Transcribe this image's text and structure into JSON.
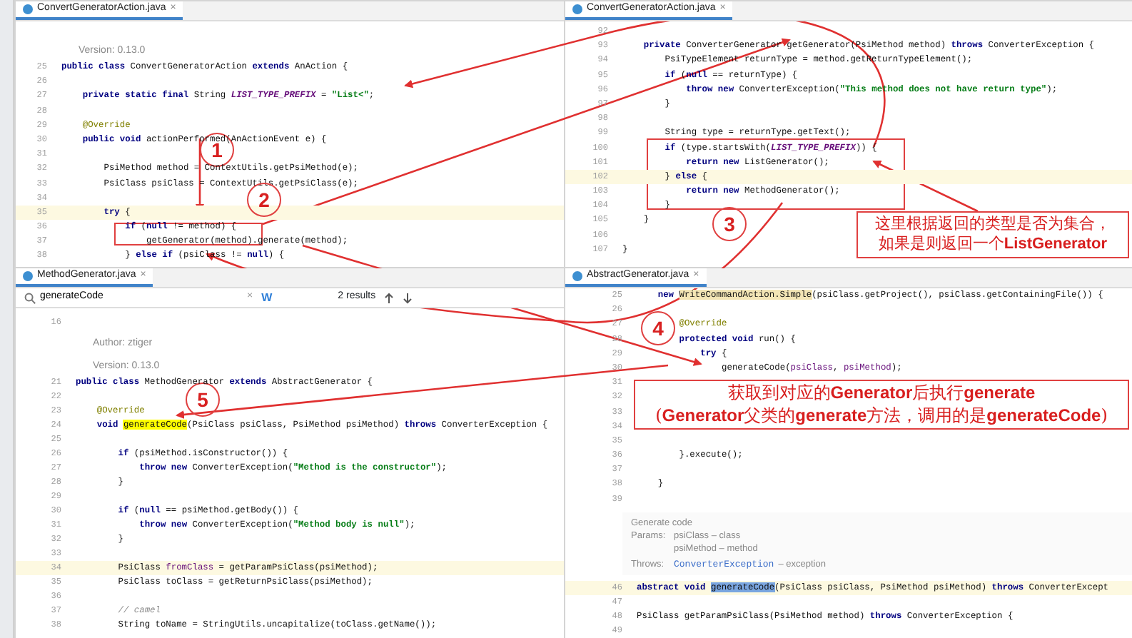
{
  "panes": [
    {
      "tab": {
        "label": "ConvertGeneratorAction.java",
        "close": "×"
      },
      "lines": [
        {
          "kind": "doc",
          "text": "Version: 0.13.0"
        },
        {
          "kind": "code",
          "num": "25",
          "current": false,
          "segs": [
            {
              "text": "public class ",
              "kind": "keyword"
            },
            {
              "text": "ConvertGeneratorAction "
            },
            {
              "text": "extends ",
              "kind": "keyword"
            },
            {
              "text": "AnAction {"
            }
          ]
        },
        {
          "kind": "code",
          "num": "26",
          "current": false
        },
        {
          "kind": "code",
          "num": "27",
          "current": false,
          "segs": [
            {
              "text": "    private static final ",
              "kind": "keyword"
            },
            {
              "text": "String "
            },
            {
              "text": "LIST_TYPE_PREFIX",
              "kind": "constant"
            },
            {
              "text": " = "
            },
            {
              "text": "\"List<\"",
              "kind": "string"
            },
            {
              "text": ";"
            }
          ]
        },
        {
          "kind": "code",
          "num": "28",
          "current": false
        },
        {
          "kind": "code",
          "num": "29",
          "current": false,
          "segs": [
            {
              "text": "    @Override",
              "kind": "annotation"
            }
          ]
        },
        {
          "kind": "code",
          "num": "30",
          "current": false,
          "segs": [
            {
              "text": "    public void ",
              "kind": "keyword"
            },
            {
              "text": "actionPerformed(AnActionEvent e) {"
            }
          ]
        },
        {
          "kind": "code",
          "num": "31",
          "current": false
        },
        {
          "kind": "code",
          "num": "32",
          "current": false,
          "segs": [
            {
              "text": "        PsiMethod method = ContextUtils.getPsiMethod(e);"
            }
          ]
        },
        {
          "kind": "code",
          "num": "33",
          "current": false,
          "segs": [
            {
              "text": "        PsiClass psiClass = ContextUtils.getPsiClass(e);"
            }
          ]
        },
        {
          "kind": "code",
          "num": "34",
          "current": false
        },
        {
          "kind": "code",
          "num": "35",
          "current": true,
          "segs": [
            {
              "text": "        try ",
              "kind": "keyword"
            },
            {
              "text": "{"
            }
          ]
        },
        {
          "kind": "code",
          "num": "36",
          "current": false,
          "segs": [
            {
              "text": "            if ",
              "kind": "keyword"
            },
            {
              "text": "("
            },
            {
              "text": "null",
              "kind": "keyword"
            },
            {
              "text": " != method) {"
            }
          ]
        },
        {
          "kind": "code",
          "num": "37",
          "current": false,
          "segs": [
            {
              "text": "                getGenerator(method).generate(method);"
            }
          ]
        },
        {
          "kind": "code",
          "num": "38",
          "current": false,
          "segs": [
            {
              "text": "            } "
            },
            {
              "text": "else if ",
              "kind": "keyword"
            },
            {
              "text": "(psiClass != "
            },
            {
              "text": "null",
              "kind": "keyword"
            },
            {
              "text": ") {"
            }
          ]
        }
      ]
    },
    {
      "tab": {
        "label": "ConvertGeneratorAction.java",
        "close": "×"
      },
      "lines": [
        {
          "kind": "code",
          "num": "92",
          "current": false
        },
        {
          "kind": "code",
          "num": "93",
          "current": false,
          "segs": [
            {
              "text": "    private ",
              "kind": "keyword"
            },
            {
              "text": "ConverterGenerator getGenerator(PsiMethod method) "
            },
            {
              "text": "throws ",
              "kind": "keyword"
            },
            {
              "text": "ConverterException {"
            }
          ]
        },
        {
          "kind": "code",
          "num": "94",
          "current": false,
          "segs": [
            {
              "text": "        PsiTypeElement returnType = method.getReturnTypeElement();"
            }
          ]
        },
        {
          "kind": "code",
          "num": "95",
          "current": false,
          "segs": [
            {
              "text": "        if ",
              "kind": "keyword"
            },
            {
              "text": "("
            },
            {
              "text": "null",
              "kind": "keyword"
            },
            {
              "text": " == returnType) {"
            }
          ]
        },
        {
          "kind": "code",
          "num": "96",
          "current": false,
          "segs": [
            {
              "text": "            throw new ",
              "kind": "keyword"
            },
            {
              "text": "ConverterException("
            },
            {
              "text": "\"This method does not have return type\"",
              "kind": "string"
            },
            {
              "text": ");"
            }
          ]
        },
        {
          "kind": "code",
          "num": "97",
          "current": false,
          "segs": [
            {
              "text": "        }"
            }
          ]
        },
        {
          "kind": "code",
          "num": "98",
          "current": false
        },
        {
          "kind": "code",
          "num": "99",
          "current": false,
          "segs": [
            {
              "text": "        String type = returnType.getText();"
            }
          ]
        },
        {
          "kind": "code",
          "num": "100",
          "current": false,
          "segs": [
            {
              "text": "        if ",
              "kind": "keyword"
            },
            {
              "text": "(type.startsWith("
            },
            {
              "text": "LIST_TYPE_PREFIX",
              "kind": "constant"
            },
            {
              "text": ")) {"
            }
          ]
        },
        {
          "kind": "code",
          "num": "101",
          "current": false,
          "segs": [
            {
              "text": "            return new ",
              "kind": "keyword"
            },
            {
              "text": "ListGenerator();"
            }
          ]
        },
        {
          "kind": "code",
          "num": "102",
          "current": true,
          "segs": [
            {
              "text": "        } "
            },
            {
              "text": "else ",
              "kind": "keyword"
            },
            {
              "text": "{"
            }
          ]
        },
        {
          "kind": "code",
          "num": "103",
          "current": false,
          "segs": [
            {
              "text": "            return new ",
              "kind": "keyword"
            },
            {
              "text": "MethodGenerator();"
            }
          ]
        },
        {
          "kind": "code",
          "num": "104",
          "current": false,
          "segs": [
            {
              "text": "        }"
            }
          ]
        },
        {
          "kind": "code",
          "num": "105",
          "current": false,
          "segs": [
            {
              "text": "    }"
            }
          ]
        },
        {
          "kind": "code",
          "num": "106",
          "current": false
        },
        {
          "kind": "code",
          "num": "107",
          "current": false,
          "segs": [
            {
              "text": "}"
            }
          ]
        }
      ]
    },
    {
      "tab": {
        "label": "MethodGenerator.java",
        "close": "×"
      },
      "search": {
        "value": "generateCode",
        "clear": "×",
        "toggle": {
          "label": "W",
          "on": true
        },
        "results": "2 results"
      },
      "lines": [
        {
          "kind": "code",
          "num": "16",
          "current": false
        },
        {
          "kind": "doc",
          "text": "Author: ztiger"
        },
        {
          "kind": "doc",
          "text": "Version: 0.13.0"
        },
        {
          "kind": "code",
          "num": "21",
          "current": false,
          "segs": [
            {
              "text": "public class ",
              "kind": "keyword"
            },
            {
              "text": "MethodGenerator "
            },
            {
              "text": "extends ",
              "kind": "keyword"
            },
            {
              "text": "AbstractGenerator {"
            }
          ]
        },
        {
          "kind": "code",
          "num": "22",
          "current": false
        },
        {
          "kind": "code",
          "num": "23",
          "current": false,
          "segs": [
            {
              "text": "    @Override",
              "kind": "annotation"
            }
          ]
        },
        {
          "kind": "code",
          "num": "24",
          "current": false,
          "segs": [
            {
              "text": "    void ",
              "kind": "keyword"
            },
            {
              "text": "generateCode",
              "kind": "match"
            },
            {
              "text": "(PsiClass psiClass, PsiMethod psiMethod) "
            },
            {
              "text": "throws ",
              "kind": "keyword"
            },
            {
              "text": "ConverterException {"
            }
          ]
        },
        {
          "kind": "code",
          "num": "25",
          "current": false
        },
        {
          "kind": "code",
          "num": "26",
          "current": false,
          "segs": [
            {
              "text": "        if ",
              "kind": "keyword"
            },
            {
              "text": "(psiMethod.isConstructor()) {"
            }
          ]
        },
        {
          "kind": "code",
          "num": "27",
          "current": false,
          "segs": [
            {
              "text": "            throw new ",
              "kind": "keyword"
            },
            {
              "text": "ConverterException("
            },
            {
              "text": "\"Method is the constructor\"",
              "kind": "string"
            },
            {
              "text": ");"
            }
          ]
        },
        {
          "kind": "code",
          "num": "28",
          "current": false,
          "segs": [
            {
              "text": "        }"
            }
          ]
        },
        {
          "kind": "code",
          "num": "29",
          "current": false
        },
        {
          "kind": "code",
          "num": "30",
          "current": false,
          "segs": [
            {
              "text": "        if ",
              "kind": "keyword"
            },
            {
              "text": "("
            },
            {
              "text": "null",
              "kind": "keyword"
            },
            {
              "text": " == psiMethod.getBody()) {"
            }
          ]
        },
        {
          "kind": "code",
          "num": "31",
          "current": false,
          "segs": [
            {
              "text": "            throw new ",
              "kind": "keyword"
            },
            {
              "text": "ConverterException("
            },
            {
              "text": "\"Method body is null\"",
              "kind": "string"
            },
            {
              "text": ");"
            }
          ]
        },
        {
          "kind": "code",
          "num": "32",
          "current": false,
          "segs": [
            {
              "text": "        }"
            }
          ]
        },
        {
          "kind": "code",
          "num": "33",
          "current": false
        },
        {
          "kind": "code",
          "num": "34",
          "current": true,
          "segs": [
            {
              "text": "        PsiClass "
            },
            {
              "text": "fromClass",
              "kind": "param"
            },
            {
              "text": " = getParamPsiClass(psiMethod);"
            }
          ]
        },
        {
          "kind": "code",
          "num": "35",
          "current": false,
          "segs": [
            {
              "text": "        PsiClass toClass = getReturnPsiClass(psiMethod);"
            }
          ]
        },
        {
          "kind": "code",
          "num": "36",
          "current": false
        },
        {
          "kind": "code",
          "num": "37",
          "current": false,
          "segs": [
            {
              "text": "        // camel",
              "kind": "comment"
            }
          ]
        },
        {
          "kind": "code",
          "num": "38",
          "current": false,
          "segs": [
            {
              "text": "        String toName = StringUtils.uncapitalize(toClass.getName());"
            }
          ]
        }
      ]
    },
    {
      "tab": {
        "label": "AbstractGenerator.java",
        "close": "×"
      },
      "lines": [
        {
          "kind": "code",
          "num": "25",
          "current": false,
          "segs": [
            {
              "text": "    new ",
              "kind": "keyword"
            },
            {
              "text": "WriteCommandAction.Simple",
              "kind": "warning"
            },
            {
              "text": "(psiClass.getProject(), psiClass.getContainingFile()) {"
            }
          ]
        },
        {
          "kind": "code",
          "num": "26",
          "current": false
        },
        {
          "kind": "code",
          "num": "27",
          "current": false,
          "segs": [
            {
              "text": "        @Override",
              "kind": "annotation"
            }
          ]
        },
        {
          "kind": "code",
          "num": "28",
          "current": false,
          "segs": [
            {
              "text": "        protected void ",
              "kind": "keyword"
            },
            {
              "text": "run() {"
            }
          ]
        },
        {
          "kind": "code",
          "num": "29",
          "current": false,
          "segs": [
            {
              "text": "            try ",
              "kind": "keyword"
            },
            {
              "text": "{"
            }
          ]
        },
        {
          "kind": "code",
          "num": "30",
          "current": false,
          "segs": [
            {
              "text": "                generateCode("
            },
            {
              "text": "psiClass",
              "kind": "param"
            },
            {
              "text": ", "
            },
            {
              "text": "psiMethod",
              "kind": "param"
            },
            {
              "text": ");"
            }
          ]
        },
        {
          "kind": "code",
          "num": "31",
          "current": false
        },
        {
          "kind": "code",
          "num": "32",
          "current": false
        },
        {
          "kind": "code",
          "num": "33",
          "current": false
        },
        {
          "kind": "code",
          "num": "34",
          "current": false
        },
        {
          "kind": "code",
          "num": "35",
          "current": false
        },
        {
          "kind": "code",
          "num": "36",
          "current": false,
          "segs": [
            {
              "text": "        }.execute();"
            }
          ]
        },
        {
          "kind": "code",
          "num": "37",
          "current": false
        },
        {
          "kind": "code",
          "num": "38",
          "current": false,
          "segs": [
            {
              "text": "    }"
            }
          ]
        },
        {
          "kind": "code",
          "num": "39",
          "current": false
        },
        {
          "kind": "javadoc",
          "title": "Generate code",
          "params_label": "Params:",
          "params": [
            "psiClass – class",
            "psiMethod – method"
          ],
          "throws_label": "Throws:",
          "throws_type": "ConverterException",
          "throws_text": "– exception"
        },
        {
          "kind": "code",
          "num": "46",
          "current": true,
          "segs": [
            {
              "text": "abstract void ",
              "kind": "keyword"
            },
            {
              "text": "generateCode",
              "kind": "selection"
            },
            {
              "text": "(PsiClass psiClass, PsiMethod psiMethod) "
            },
            {
              "text": "throws ",
              "kind": "keyword"
            },
            {
              "text": "ConverterExcept"
            }
          ]
        },
        {
          "kind": "code",
          "num": "47",
          "current": false
        },
        {
          "kind": "code",
          "num": "48",
          "current": false,
          "segs": [
            {
              "text": "PsiClass getParamPsiClass(PsiMethod method) "
            },
            {
              "text": "throws ",
              "kind": "keyword"
            },
            {
              "text": "ConverterException {"
            }
          ]
        },
        {
          "kind": "code",
          "num": "49",
          "current": false
        }
      ]
    }
  ],
  "annotations": {
    "steps": [
      "1",
      "2",
      "3",
      "4",
      "5"
    ],
    "callouts": [
      {
        "lines": [
          "这里根据返回的类型是否为集合，",
          "如果是则返回一个**ListGenerator**"
        ]
      },
      {
        "lines": [
          "获取到对应的**Generator**后执行**generate**",
          "(**Generator**父类的**generate**方法，调用的是**generateCode**)"
        ]
      }
    ]
  }
}
